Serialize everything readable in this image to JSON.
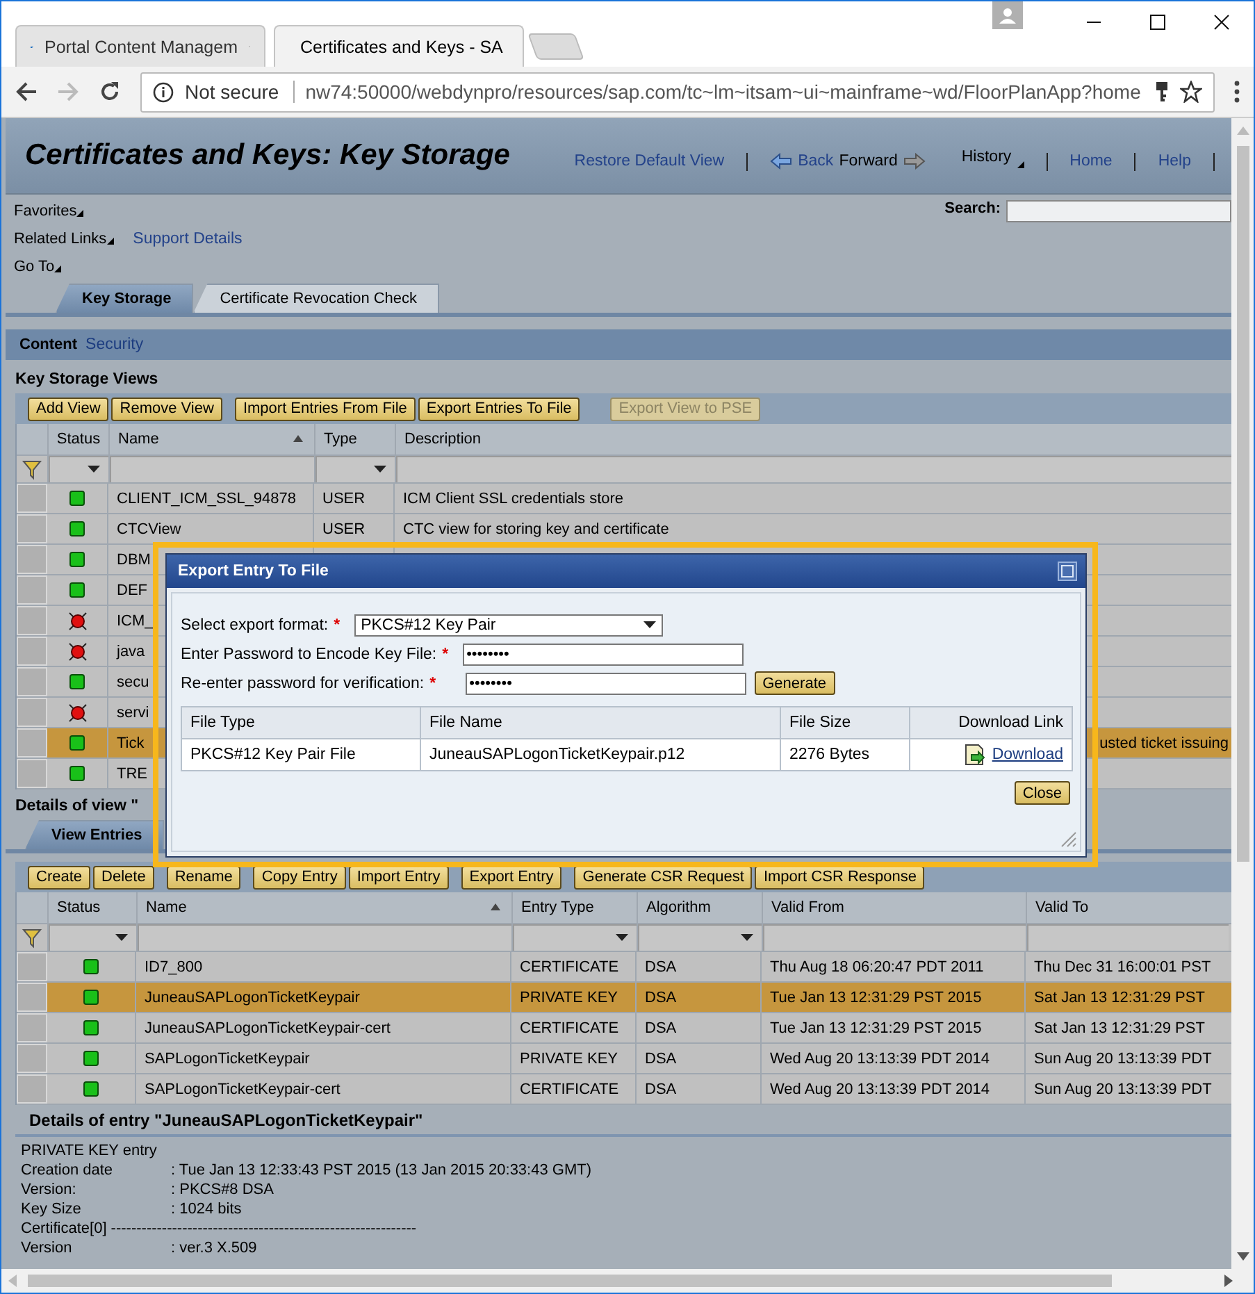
{
  "browser": {
    "tabs": [
      {
        "title": "Portal Content Managem",
        "selected": false
      },
      {
        "title": "Certificates and Keys - SA",
        "selected": true
      }
    ],
    "security": "Not secure",
    "url": "nw74:50000/webdynpro/resources/sap.com/tc~lm~itsam~ui~mainframe~wd/FloorPlanApp?home"
  },
  "header": {
    "title": "Certificates and Keys: Key Storage",
    "restore": "Restore Default View",
    "back": "Back",
    "forward": "Forward",
    "history": "History",
    "home": "Home",
    "help": "Help"
  },
  "nav": {
    "favorites": "Favorites",
    "related": "Related Links",
    "support": "Support Details",
    "goto": "Go To",
    "search_label": "Search:"
  },
  "tabs": [
    {
      "label": "Key Storage",
      "selected": true
    },
    {
      "label": "Certificate Revocation Check",
      "selected": false
    }
  ],
  "breadcrumb": {
    "current": "Content",
    "link": "Security"
  },
  "views": {
    "title": "Key Storage Views",
    "buttons": [
      {
        "label": "Add View",
        "disabled": false
      },
      {
        "label": "Remove View",
        "disabled": false
      },
      {
        "label": "Import Entries From File",
        "disabled": false
      },
      {
        "label": "Export Entries To File",
        "disabled": false
      },
      {
        "label": "Export View to PSE",
        "disabled": true
      }
    ],
    "columns": [
      {
        "label": "Status",
        "filter": true,
        "sorted": false
      },
      {
        "label": "Name",
        "filter": false,
        "sorted": true
      },
      {
        "label": "Type",
        "filter": true,
        "sorted": false
      },
      {
        "label": "Description",
        "filter": false,
        "sorted": false
      }
    ],
    "rows": [
      {
        "error": false,
        "name": "CLIENT_ICM_SSL_94878",
        "type": "USER",
        "description": " ICM Client SSL credentials store",
        "selected": false
      },
      {
        "error": false,
        "name": "CTCView",
        "type": "USER",
        "description": "CTC view for storing key and certificate",
        "selected": false
      },
      {
        "error": false,
        "name": "DBM",
        "selected": false
      },
      {
        "error": false,
        "name": "DEF",
        "selected": false
      },
      {
        "error": true,
        "name": "ICM_",
        "selected": false
      },
      {
        "error": true,
        "name": "java",
        "selected": false
      },
      {
        "error": false,
        "name": "secu",
        "selected": false
      },
      {
        "error": true,
        "name": "servi",
        "selected": false
      },
      {
        "error": false,
        "name": "Tick",
        "description": "usted ticket issuing",
        "selected": true
      },
      {
        "error": false,
        "name": "TRE",
        "selected": false
      }
    ]
  },
  "entries": {
    "title": "Details of view \"",
    "tab": "View Entries",
    "buttons": [
      "Create",
      "Delete",
      "Rename",
      "Copy Entry",
      "Import Entry",
      "Export Entry",
      "Generate CSR Request",
      "Import CSR Response"
    ],
    "columns": [
      {
        "label": "Status",
        "filter": true,
        "sorted": false
      },
      {
        "label": "Name",
        "filter": false,
        "sorted": true
      },
      {
        "label": "Entry Type",
        "filter": true,
        "sorted": false
      },
      {
        "label": "Algorithm",
        "filter": true,
        "sorted": false
      },
      {
        "label": "Valid From",
        "filter": false,
        "sorted": false
      },
      {
        "label": "Valid To",
        "filter": false,
        "sorted": false
      }
    ],
    "rows": [
      {
        "error": false,
        "name": "ID7_800",
        "entry_type": "CERTIFICATE",
        "algorithm": "DSA",
        "valid_from": "Thu Aug 18 06:20:47 PDT 2011",
        "valid_to": "Thu Dec 31 16:00:01 PST",
        "selected": false
      },
      {
        "error": false,
        "name": "JuneauSAPLogonTicketKeypair",
        "entry_type": "PRIVATE KEY",
        "algorithm": "DSA",
        "valid_from": "Tue Jan 13 12:31:29 PST 2015",
        "valid_to": "Sat Jan 13 12:31:29 PST",
        "selected": true
      },
      {
        "error": false,
        "name": "JuneauSAPLogonTicketKeypair-cert",
        "entry_type": "CERTIFICATE",
        "algorithm": "DSA",
        "valid_from": "Tue Jan 13 12:31:29 PST 2015",
        "valid_to": "Sat Jan 13 12:31:29 PST",
        "selected": false
      },
      {
        "error": false,
        "name": "SAPLogonTicketKeypair",
        "entry_type": "PRIVATE KEY",
        "algorithm": "DSA",
        "valid_from": "Wed Aug 20 13:13:39 PDT 2014",
        "valid_to": "Sun Aug 20 13:13:39 PDT",
        "selected": false
      },
      {
        "error": false,
        "name": "SAPLogonTicketKeypair-cert",
        "entry_type": "CERTIFICATE",
        "algorithm": "DSA",
        "valid_from": "Wed Aug 20 13:13:39 PDT 2014",
        "valid_to": "Sun Aug 20 13:13:39 PDT",
        "selected": false
      }
    ]
  },
  "details": {
    "title": "Details of entry \"JuneauSAPLogonTicketKeypair\"",
    "lines": [
      {
        "label": "PRIVATE KEY entry"
      },
      {
        "label": "Creation date",
        "value": ": Tue Jan 13 12:33:43 PST 2015 (13 Jan 2015 20:33:43 GMT)"
      },
      {
        "label": "Version:",
        "value": ": PKCS#8 DSA"
      },
      {
        "label": "Key Size",
        "value": ": 1024 bits"
      },
      {
        "label": "Certificate[0] ------------------------------------------------------------"
      },
      {
        "label": "Version",
        "value": ": ver.3 X.509"
      }
    ]
  },
  "dialog": {
    "title": "Export Entry To File",
    "fields": [
      {
        "kind": "select",
        "label": "Select export format:",
        "required_mark": "*",
        "value": "PKCS#12 Key Pair"
      },
      {
        "kind": "password",
        "label": "Enter Password to Encode Key File:",
        "required_mark": "*",
        "value": "••••••••"
      },
      {
        "kind": "password",
        "label": "Re-enter password for verification:",
        "required_mark": "*",
        "value": "••••••••"
      }
    ],
    "generate": "Generate",
    "columns": [
      "File Type",
      "File Name",
      "File Size",
      "Download Link"
    ],
    "file": {
      "type": "PKCS#12 Key Pair File",
      "name": "JuneauSAPLogonTicketKeypair.p12",
      "size": "2276 Bytes",
      "link": "Download"
    },
    "close": "Close"
  }
}
